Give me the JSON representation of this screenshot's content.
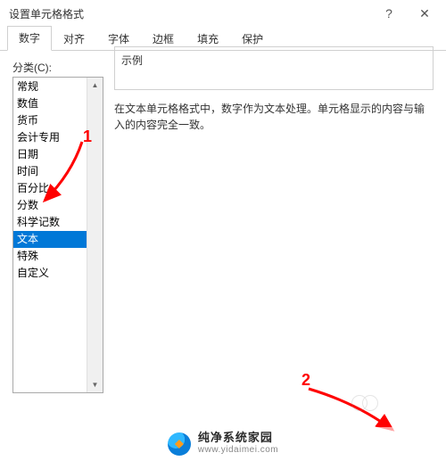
{
  "window": {
    "title": "设置单元格格式"
  },
  "tabs": [
    {
      "label": "数字",
      "active": true
    },
    {
      "label": "对齐",
      "active": false
    },
    {
      "label": "字体",
      "active": false
    },
    {
      "label": "边框",
      "active": false
    },
    {
      "label": "填充",
      "active": false
    },
    {
      "label": "保护",
      "active": false
    }
  ],
  "category_label": "分类(C):",
  "categories": [
    {
      "label": "常规",
      "selected": false
    },
    {
      "label": "数值",
      "selected": false
    },
    {
      "label": "货币",
      "selected": false
    },
    {
      "label": "会计专用",
      "selected": false
    },
    {
      "label": "日期",
      "selected": false
    },
    {
      "label": "时间",
      "selected": false
    },
    {
      "label": "百分比",
      "selected": false
    },
    {
      "label": "分数",
      "selected": false
    },
    {
      "label": "科学记数",
      "selected": false
    },
    {
      "label": "文本",
      "selected": true
    },
    {
      "label": "特殊",
      "selected": false
    },
    {
      "label": "自定义",
      "selected": false
    }
  ],
  "sample_label": "示例",
  "description": "在文本单元格格式中，数字作为文本处理。单元格显示的内容与输入的内容完全一致。",
  "annotations": {
    "label1": "1",
    "label2": "2"
  },
  "watermark": {
    "name": "纯净系统家园",
    "url": "www.yidaimei.com"
  },
  "colors": {
    "selection": "#0078d7",
    "annotation": "#ff0000"
  }
}
